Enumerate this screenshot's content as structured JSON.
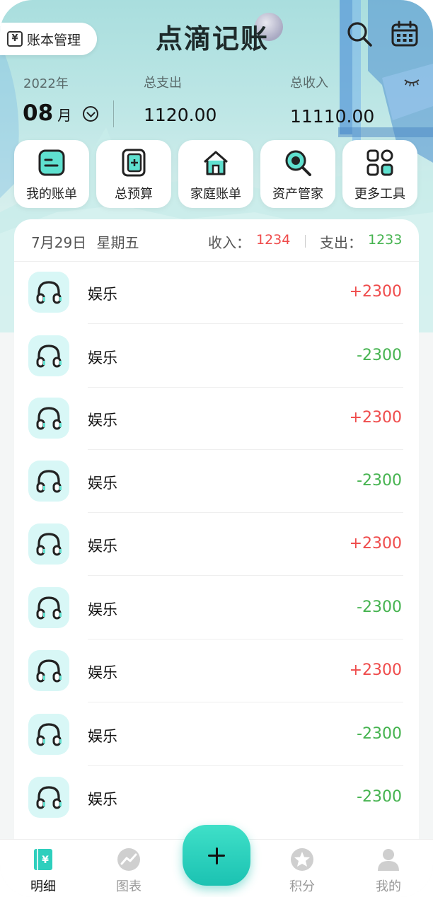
{
  "header": {
    "ledger_manage_label": "账本管理",
    "app_title": "点滴记账"
  },
  "summary": {
    "year": "2022年",
    "month": "08",
    "month_unit": "月",
    "total_expense_label": "总支出",
    "total_expense": "1120.00",
    "total_income_label": "总收入",
    "total_income": "11110.00"
  },
  "tools": [
    {
      "label": "我的账单",
      "icon": "bill-icon"
    },
    {
      "label": "总预算",
      "icon": "budget-icon"
    },
    {
      "label": "家庭账单",
      "icon": "home-icon"
    },
    {
      "label": "资产管家",
      "icon": "asset-search-icon"
    },
    {
      "label": "更多工具",
      "icon": "grid-icon"
    }
  ],
  "day": {
    "date": "7月29日",
    "weekday": "星期五",
    "income_label": "收入：",
    "income": "1234",
    "expense_label": "支出：",
    "expense": "1233"
  },
  "records": [
    {
      "category": "娱乐",
      "amount": "+2300",
      "type": "income"
    },
    {
      "category": "娱乐",
      "amount": "-2300",
      "type": "expense"
    },
    {
      "category": "娱乐",
      "amount": "+2300",
      "type": "income"
    },
    {
      "category": "娱乐",
      "amount": "-2300",
      "type": "expense"
    },
    {
      "category": "娱乐",
      "amount": "+2300",
      "type": "income"
    },
    {
      "category": "娱乐",
      "amount": "-2300",
      "type": "expense"
    },
    {
      "category": "娱乐",
      "amount": "+2300",
      "type": "income"
    },
    {
      "category": "娱乐",
      "amount": "-2300",
      "type": "expense"
    },
    {
      "category": "娱乐",
      "amount": "-2300",
      "type": "expense"
    }
  ],
  "tabbar": {
    "tabs": [
      {
        "label": "明细",
        "icon": "ledger-book-icon",
        "active": true
      },
      {
        "label": "图表",
        "icon": "chart-icon",
        "active": false
      },
      {
        "label": "积分",
        "icon": "star-badge-icon",
        "active": false
      },
      {
        "label": "我的",
        "icon": "user-icon",
        "active": false
      }
    ],
    "add_icon": "plus-icon"
  },
  "colors": {
    "income": "#ef4b4b",
    "expense": "#45b34f",
    "accent": "#1bc2b2",
    "badge_bg": "#d8f7f6"
  }
}
